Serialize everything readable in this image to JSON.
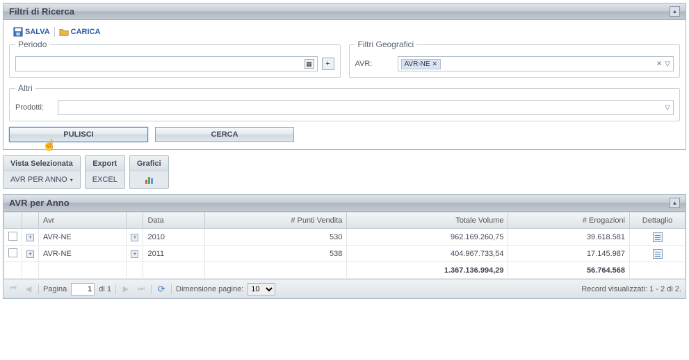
{
  "filters_panel": {
    "title": "Filtri di Ricerca",
    "save": "SALVA",
    "load": "CARICA",
    "periodo_legend": "Periodo",
    "geo_legend": "Filtri Geografici",
    "avr_label": "AVR:",
    "avr_tag": "AVR-NE",
    "altri_legend": "Altri",
    "prodotti_label": "Prodotti:",
    "clear_btn": "PULISCI",
    "search_btn": "CERCA"
  },
  "actions": {
    "view_head": "Vista Selezionata",
    "view_value": "AVR PER ANNO",
    "export_head": "Export",
    "export_value": "EXCEL",
    "chart_head": "Grafici"
  },
  "grid_panel": {
    "title": "AVR per Anno",
    "headers": {
      "avr": "Avr",
      "data": "Data",
      "punti": "# Punti Vendita",
      "volume": "Totale Volume",
      "erogazioni": "# Erogazioni",
      "dettaglio": "Dettaglio"
    },
    "rows": [
      {
        "avr": "AVR-NE",
        "data": "2010",
        "punti": "530",
        "volume": "962.169.260,75",
        "erogazioni": "39.618.581"
      },
      {
        "avr": "AVR-NE",
        "data": "2011",
        "punti": "538",
        "volume": "404.967.733,54",
        "erogazioni": "17.145.987"
      }
    ],
    "totals": {
      "volume": "1.367.136.994,29",
      "erogazioni": "56.764.568"
    }
  },
  "pager": {
    "page_label": "Pagina",
    "page_value": "1",
    "of_label": "di 1",
    "size_label": "Dimensione pagine:",
    "size_value": "10",
    "records": "Record visualizzati: 1 - 2 di 2."
  }
}
